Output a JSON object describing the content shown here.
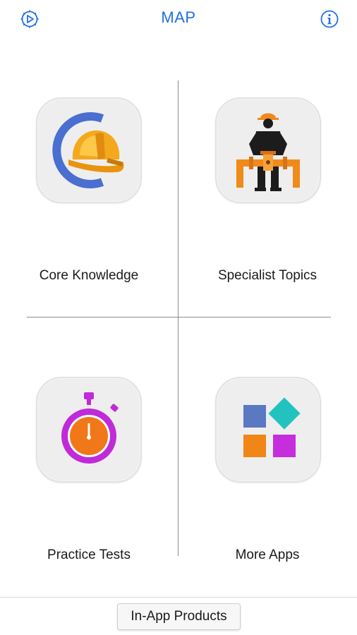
{
  "header": {
    "title": "MAP",
    "left_icon": "play-gear-icon",
    "right_icon": "info-icon",
    "accent_color": "#1f6fe5"
  },
  "tiles": [
    {
      "label": "Core Knowledge",
      "icon": "hardhat-c-icon"
    },
    {
      "label": "Specialist Topics",
      "icon": "worker-pipe-icon"
    },
    {
      "label": "Practice Tests",
      "icon": "stopwatch-icon"
    },
    {
      "label": "More Apps",
      "icon": "app-grid-icon"
    }
  ],
  "footer": {
    "button_label": "In-App Products"
  }
}
